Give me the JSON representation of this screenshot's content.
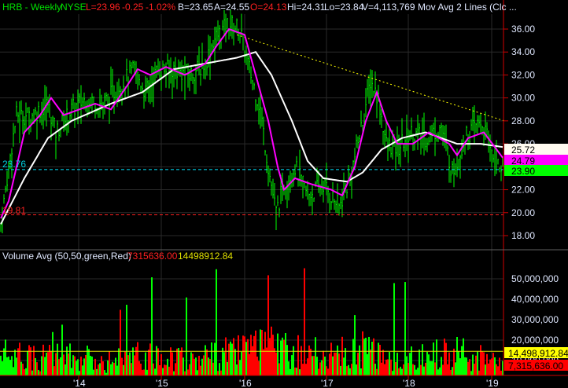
{
  "header": {
    "symbol": "HRB - Weekly",
    "exchange": "NYSE",
    "last": "L=23.96",
    "change": "-0.25",
    "change_pct": "-1.02%",
    "bid": "B=23.65",
    "ask": "A=24.55",
    "open": "O=24.13",
    "high": "Hi=24.31",
    "low": "Lo=23.84",
    "volume": "V=4,113,769",
    "study": "Mov Avg 2 Lines (Clc ..."
  },
  "volume_header": {
    "label": "Volume Avg (50,50,green,Red)",
    "value_red": "7315636.00",
    "value_yellow": "14498912.84"
  },
  "colors": {
    "up": "#00ff00",
    "down": "#ff0000",
    "fast_ma": "#ff00ff",
    "slow_ma": "#ffffff",
    "trend": "#ffff00",
    "support": "#00e5ff",
    "low_line": "#ff2020"
  },
  "chart_data": {
    "type": "line",
    "title": "HRB - Weekly",
    "price_axis": {
      "min": 18,
      "max": 36,
      "ticks": [
        "36.00",
        "34.00",
        "32.00",
        "30.00",
        "28.00",
        "26.00",
        "24.00",
        "22.00",
        "20.00",
        "18.00"
      ]
    },
    "volume_axis": {
      "ticks": [
        "50,000,000",
        "40,000,000",
        "30,000,000",
        "20,000,000",
        "10,000,000"
      ]
    },
    "x_tick_labels": [
      "'14",
      "'15",
      "'16",
      "'17",
      "'18",
      "'19"
    ],
    "weeks": 320,
    "close_knots": [
      [
        0,
        19
      ],
      [
        5,
        24
      ],
      [
        10,
        28.5
      ],
      [
        20,
        28.5
      ],
      [
        30,
        29.5
      ],
      [
        35,
        27
      ],
      [
        45,
        29
      ],
      [
        55,
        30
      ],
      [
        65,
        29.5
      ],
      [
        75,
        31
      ],
      [
        85,
        32.5
      ],
      [
        92,
        30.5
      ],
      [
        100,
        32.5
      ],
      [
        110,
        32.5
      ],
      [
        120,
        32
      ],
      [
        130,
        33
      ],
      [
        135,
        35
      ],
      [
        145,
        36.5
      ],
      [
        152,
        36
      ],
      [
        157,
        33
      ],
      [
        165,
        29
      ],
      [
        170,
        24
      ],
      [
        175,
        20
      ],
      [
        180,
        22.5
      ],
      [
        187,
        24
      ],
      [
        195,
        21.5
      ],
      [
        205,
        22.5
      ],
      [
        215,
        20.5
      ],
      [
        222,
        23
      ],
      [
        230,
        28
      ],
      [
        235,
        31.5
      ],
      [
        240,
        30
      ],
      [
        245,
        26
      ],
      [
        252,
        25.5
      ],
      [
        260,
        27
      ],
      [
        270,
        26.5
      ],
      [
        280,
        27.5
      ],
      [
        287,
        23.5
      ],
      [
        295,
        26.5
      ],
      [
        305,
        28
      ],
      [
        312,
        25.5
      ],
      [
        319,
        23.96
      ]
    ],
    "fast_ma_knots": [
      [
        0,
        19.5
      ],
      [
        5,
        21
      ],
      [
        15,
        27
      ],
      [
        25,
        28.5
      ],
      [
        32,
        30
      ],
      [
        40,
        28.5
      ],
      [
        50,
        29
      ],
      [
        60,
        29.5
      ],
      [
        70,
        29
      ],
      [
        80,
        31
      ],
      [
        87,
        32.5
      ],
      [
        95,
        32
      ],
      [
        105,
        32.7
      ],
      [
        117,
        32
      ],
      [
        130,
        33
      ],
      [
        137,
        34.5
      ],
      [
        145,
        36
      ],
      [
        155,
        35.5
      ],
      [
        162,
        32
      ],
      [
        170,
        28
      ],
      [
        176,
        24
      ],
      [
        180,
        22
      ],
      [
        187,
        23
      ],
      [
        197,
        22.5
      ],
      [
        210,
        22
      ],
      [
        217,
        21.5
      ],
      [
        225,
        24
      ],
      [
        232,
        28
      ],
      [
        239,
        30.5
      ],
      [
        245,
        28
      ],
      [
        252,
        26
      ],
      [
        262,
        26
      ],
      [
        272,
        27
      ],
      [
        285,
        26
      ],
      [
        290,
        25
      ],
      [
        297,
        26.5
      ],
      [
        307,
        27
      ],
      [
        319,
        24.79
      ]
    ],
    "slow_ma_knots": [
      [
        0,
        19
      ],
      [
        15,
        23
      ],
      [
        30,
        26.5
      ],
      [
        45,
        28
      ],
      [
        70,
        29.5
      ],
      [
        90,
        30.5
      ],
      [
        110,
        32.5
      ],
      [
        130,
        33
      ],
      [
        150,
        33.5
      ],
      [
        162,
        34
      ],
      [
        172,
        32
      ],
      [
        185,
        28
      ],
      [
        195,
        24.5
      ],
      [
        205,
        23
      ],
      [
        220,
        22.7
      ],
      [
        230,
        23.5
      ],
      [
        242,
        25.5
      ],
      [
        255,
        26.5
      ],
      [
        270,
        27
      ],
      [
        280,
        26.5
      ],
      [
        290,
        26
      ],
      [
        305,
        26
      ],
      [
        319,
        25.72
      ]
    ],
    "volume_knots_millions": [
      [
        0,
        14
      ],
      [
        20,
        12
      ],
      [
        40,
        13
      ],
      [
        60,
        11
      ],
      [
        80,
        12
      ],
      [
        100,
        13
      ],
      [
        120,
        12
      ],
      [
        140,
        14
      ],
      [
        160,
        16
      ],
      [
        175,
        18
      ],
      [
        190,
        15
      ],
      [
        210,
        13
      ],
      [
        230,
        16
      ],
      [
        250,
        13
      ],
      [
        270,
        12
      ],
      [
        280,
        16
      ],
      [
        300,
        13
      ],
      [
        319,
        7.3
      ]
    ],
    "volume_avg_millions": 14.5,
    "trendline": {
      "from": [
        150,
        35.5
      ],
      "to": [
        320,
        28
      ]
    },
    "support_level": 23.76,
    "support_label": "23.76",
    "low_level": 19.81,
    "low_label": "19.81",
    "last_labels": {
      "slow_ma": "25.72",
      "fast_ma": "24.79",
      "close": "23.90",
      "vol_avg": "14,498,912.84",
      "vol_red": "7,315,636.00"
    }
  }
}
